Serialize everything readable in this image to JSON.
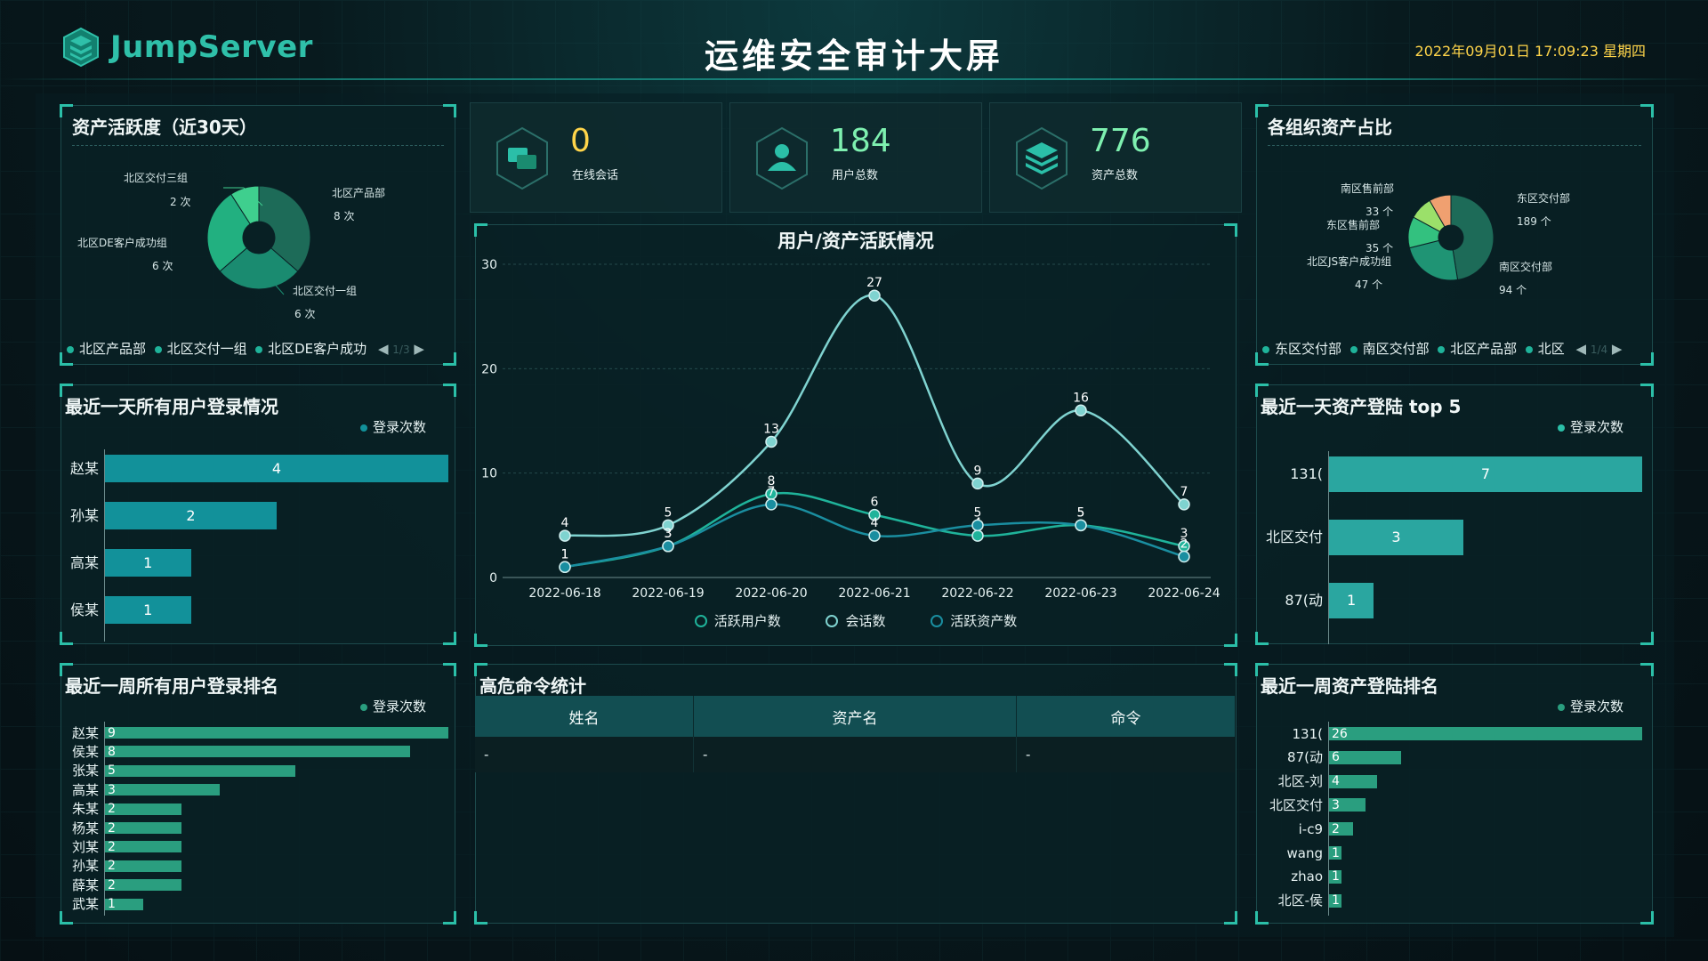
{
  "header": {
    "logo_text": "JumpServer",
    "title": "运维安全审计大屏",
    "datetime": "2022年09月01日 17:09:23 星期四"
  },
  "colors": {
    "accent": "#2bbfa8",
    "number": "#ffd54a",
    "bar": "#12919a",
    "bar_week": "#2a9e7f"
  },
  "asset_activity": {
    "title": "资产活跃度（近30天）",
    "slices": [
      {
        "name": "北区产品部",
        "value": 8,
        "label": "8 次",
        "color": "#1d6b58"
      },
      {
        "name": "北区交付一组",
        "value": 6,
        "label": "6 次",
        "color": "#1a8b70"
      },
      {
        "name": "北区DE客户成功组",
        "value": 6,
        "label": "6 次",
        "color": "#22b080"
      },
      {
        "name": "北区交付三组",
        "value": 2,
        "label": "2 次",
        "color": "#3fcf8e"
      }
    ],
    "legend": [
      "北区产品部",
      "北区交付一组",
      "北区DE客户成功"
    ],
    "page": "1/3"
  },
  "stats": [
    {
      "value": "0",
      "label": "在线会话",
      "icon": "chat-icon"
    },
    {
      "value": "184",
      "label": "用户总数",
      "icon": "user-icon"
    },
    {
      "value": "776",
      "label": "资产总数",
      "icon": "layers-icon"
    }
  ],
  "org_assets": {
    "title": "各组织资产占比",
    "slices": [
      {
        "name": "东区交付部",
        "value": 189,
        "label": "189 个",
        "color": "#1d6b58"
      },
      {
        "name": "南区交付部",
        "value": 94,
        "label": "94 个",
        "color": "#1f9474"
      },
      {
        "name": "北区JS客户成功组",
        "value": 47,
        "label": "47 个",
        "color": "#33c17f"
      },
      {
        "name": "东区售前部",
        "value": 35,
        "label": "35 个",
        "color": "#9be06a"
      },
      {
        "name": "南区售前部",
        "value": 33,
        "label": "33 个",
        "color": "#f0a070"
      }
    ],
    "legend": [
      "东区交付部",
      "南区交付部",
      "北区产品部",
      "北区"
    ],
    "page": "1/4"
  },
  "activity_chart": {
    "title": "用户/资产活跃情况",
    "legend": [
      "活跃用户数",
      "会话数",
      "活跃资产数"
    ]
  },
  "chart_data": [
    {
      "type": "line",
      "title": "用户/资产活跃情况",
      "x": [
        "2022-06-18",
        "2022-06-19",
        "2022-06-20",
        "2022-06-21",
        "2022-06-22",
        "2022-06-23",
        "2022-06-24"
      ],
      "ylim": [
        0,
        30
      ],
      "yticks": [
        0,
        10,
        20,
        30
      ],
      "series": [
        {
          "name": "活跃用户数",
          "values": [
            1,
            3,
            8,
            6,
            4,
            5,
            3
          ],
          "color": "#1fb39a"
        },
        {
          "name": "会话数",
          "values": [
            4,
            5,
            13,
            27,
            9,
            16,
            7
          ],
          "color": "#7fd3d0"
        },
        {
          "name": "活跃资产数",
          "values": [
            1,
            3,
            7,
            4,
            5,
            5,
            2
          ],
          "color": "#1a8ea0"
        }
      ]
    },
    {
      "type": "bar",
      "title": "最近一天所有用户登录情况",
      "legend": "登录次数",
      "categories": [
        "赵某",
        "孙某",
        "高某",
        "侯某"
      ],
      "values": [
        4,
        2,
        1,
        1
      ]
    },
    {
      "type": "bar",
      "title": "最近一天资产登陆 top 5",
      "legend": "登录次数",
      "categories": [
        "131(",
        "北区交付",
        "87(动"
      ],
      "values": [
        7,
        3,
        1
      ]
    },
    {
      "type": "bar",
      "title": "最近一周所有用户登录排名",
      "legend": "登录次数",
      "categories": [
        "赵某",
        "侯某",
        "张某",
        "高某",
        "朱某",
        "杨某",
        "刘某",
        "孙某",
        "薛某",
        "武某"
      ],
      "values": [
        9,
        8,
        5,
        3,
        2,
        2,
        2,
        2,
        2,
        1
      ]
    },
    {
      "type": "bar",
      "title": "最近一周资产登陆排名",
      "legend": "登录次数",
      "categories": [
        "131(",
        "87(动",
        "北区-刘",
        "北区交付",
        "i-c9",
        "wang",
        "zhao",
        "北区-侯"
      ],
      "values": [
        26,
        6,
        4,
        3,
        2,
        1,
        1,
        1
      ]
    }
  ],
  "danger_commands": {
    "title": "高危命令统计",
    "columns": [
      "姓名",
      "资产名",
      "命令"
    ],
    "rows": [
      [
        "-",
        "-",
        "-"
      ]
    ]
  }
}
